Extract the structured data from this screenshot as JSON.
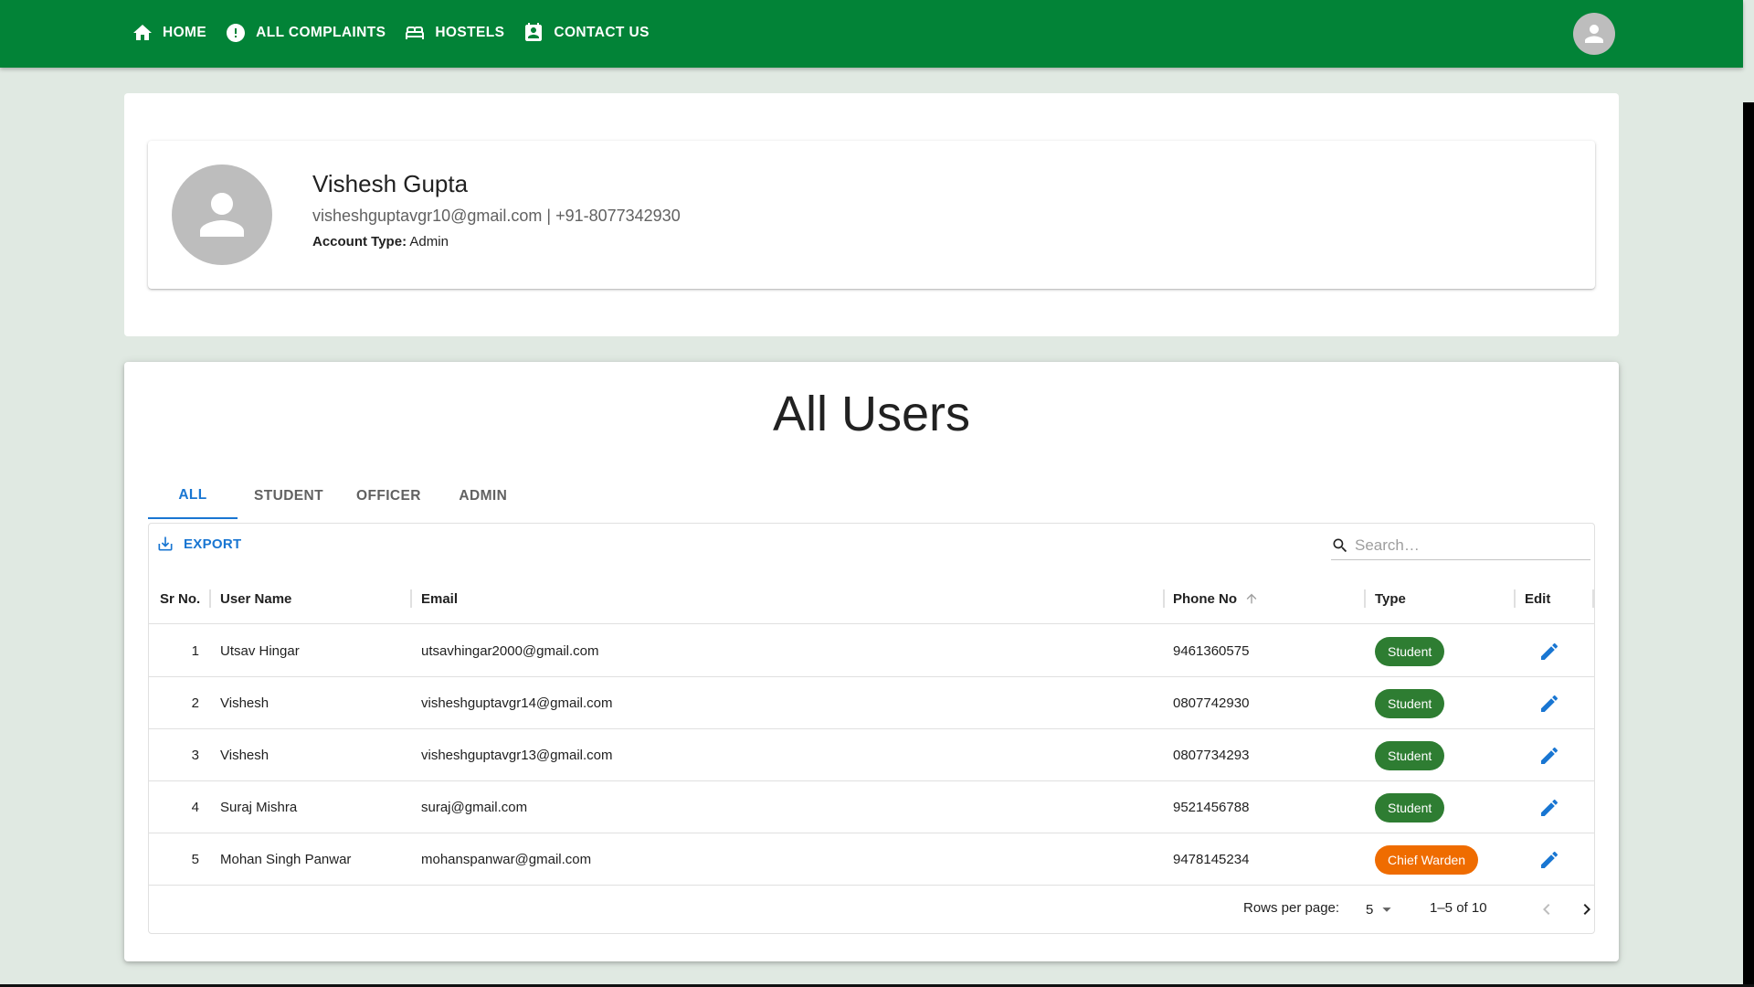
{
  "nav": {
    "items": [
      {
        "label": "HOME",
        "icon": "home-icon"
      },
      {
        "label": "ALL COMPLAINTS",
        "icon": "error-icon"
      },
      {
        "label": "HOSTELS",
        "icon": "bed-icon"
      },
      {
        "label": "CONTACT US",
        "icon": "contact-icon"
      }
    ]
  },
  "profile": {
    "name": "Vishesh Gupta",
    "contact": "visheshguptavgr10@gmail.com | +91-8077342930",
    "account_type_label": "Account Type:",
    "account_type_value": "Admin"
  },
  "users": {
    "title": "All Users",
    "tabs": [
      "ALL",
      "STUDENT",
      "OFFICER",
      "ADMIN"
    ],
    "active_tab": "ALL",
    "export_label": "EXPORT",
    "search_placeholder": "Search…",
    "columns": [
      "Sr No.",
      "User Name",
      "Email",
      "Phone No",
      "Type",
      "Edit"
    ],
    "rows": [
      {
        "sr": "1",
        "name": "Utsav Hingar",
        "email": "utsavhingar2000@gmail.com",
        "phone": "9461360575",
        "type": "Student"
      },
      {
        "sr": "2",
        "name": "Vishesh",
        "email": "visheshguptavgr14@gmail.com",
        "phone": "0807742930",
        "type": "Student"
      },
      {
        "sr": "3",
        "name": "Vishesh",
        "email": "visheshguptavgr13@gmail.com",
        "phone": "0807734293",
        "type": "Student"
      },
      {
        "sr": "4",
        "name": "Suraj Mishra",
        "email": "suraj@gmail.com",
        "phone": "9521456788",
        "type": "Student"
      },
      {
        "sr": "5",
        "name": "Mohan Singh Panwar",
        "email": "mohanspanwar@gmail.com",
        "phone": "9478145234",
        "type": "Chief Warden"
      }
    ],
    "footer": {
      "rows_per_page_label": "Rows per page:",
      "rows_per_page_value": "5",
      "range": "1–5 of 10"
    }
  },
  "colors": {
    "appbar": "#028337",
    "accent": "#1976d2",
    "chip_student": "#2e7d32",
    "chip_warden": "#ef6c00"
  }
}
